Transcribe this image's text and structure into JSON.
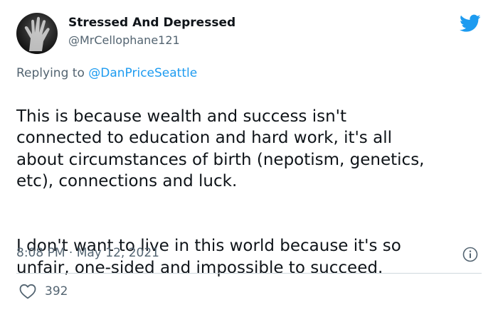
{
  "author": {
    "name": "Stressed And Depressed",
    "handle": "@MrCellophane121"
  },
  "reply": {
    "prefix": "Replying to ",
    "mention": "@DanPriceSeattle"
  },
  "tweet": {
    "paragraph_1": "This is because wealth and success isn't\nconnected to education and hard work, it's all\nabout circumstances of birth (nepotism, genetics,\netc), connections and luck.",
    "paragraph_2": "I don't want to live in this world because it's so\nunfair, one-sided and impossible to succeed."
  },
  "meta": {
    "time": "8:08 PM",
    "separator": "·",
    "date": "May 12, 2021"
  },
  "actions": {
    "likes": "392"
  },
  "icons": {
    "bird": "twitter-bird-icon",
    "info": "info-icon",
    "like": "heart-icon"
  },
  "colors": {
    "accent": "#1d9bf0",
    "secondary_text": "#536471",
    "primary_text": "#0f1419",
    "divider": "#cfd9de"
  }
}
